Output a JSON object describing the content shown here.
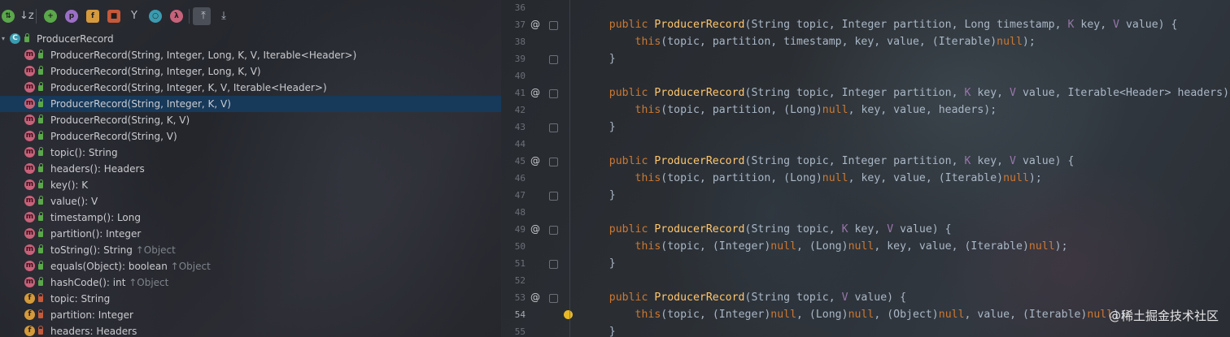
{
  "structure": {
    "toolbar": {
      "items": [
        {
          "name": "sort-by-visibility",
          "glyph": "⇅",
          "color": "#5aa84a"
        },
        {
          "name": "sort-alphabetically",
          "glyph": "↓z",
          "color": ""
        },
        {
          "name": "show-inherited",
          "glyph": "+",
          "color": "#5aa84a"
        },
        {
          "name": "show-properties",
          "glyph": "p",
          "color": "#9b6fc7"
        },
        {
          "name": "show-fields",
          "glyph": "f",
          "color": "#d59a3c"
        },
        {
          "name": "show-non-public",
          "glyph": "■",
          "color": "#c55a3a"
        },
        {
          "name": "show-anonymous",
          "glyph": "Y",
          "color": ""
        },
        {
          "name": "show-lambdas",
          "glyph": "○",
          "color": "#3b9bb0"
        },
        {
          "name": "show-lambdas-alt",
          "glyph": "λ",
          "color": "#c7627a"
        },
        {
          "name": "expand-all",
          "glyph": "⤒",
          "color": ""
        },
        {
          "name": "collapse-all",
          "glyph": "⤓",
          "color": ""
        }
      ]
    },
    "root": {
      "badge": "C",
      "label": "ProducerRecord"
    },
    "members": [
      {
        "kind": "m",
        "vis": "pub",
        "label": "ProducerRecord(String, Integer, Long, K, V, Iterable<Header>)",
        "inherited": ""
      },
      {
        "kind": "m",
        "vis": "pub",
        "label": "ProducerRecord(String, Integer, Long, K, V)",
        "inherited": ""
      },
      {
        "kind": "m",
        "vis": "pub",
        "label": "ProducerRecord(String, Integer, K, V, Iterable<Header>)",
        "inherited": ""
      },
      {
        "kind": "m",
        "vis": "pub",
        "label": "ProducerRecord(String, Integer, K, V)",
        "inherited": "",
        "selected": true
      },
      {
        "kind": "m",
        "vis": "pub",
        "label": "ProducerRecord(String, K, V)",
        "inherited": ""
      },
      {
        "kind": "m",
        "vis": "pub",
        "label": "ProducerRecord(String, V)",
        "inherited": ""
      },
      {
        "kind": "m",
        "vis": "pub",
        "label": "topic(): String",
        "inherited": ""
      },
      {
        "kind": "m",
        "vis": "pub",
        "label": "headers(): Headers",
        "inherited": ""
      },
      {
        "kind": "m",
        "vis": "pub",
        "label": "key(): K",
        "inherited": ""
      },
      {
        "kind": "m",
        "vis": "pub",
        "label": "value(): V",
        "inherited": ""
      },
      {
        "kind": "m",
        "vis": "pub",
        "label": "timestamp(): Long",
        "inherited": ""
      },
      {
        "kind": "m",
        "vis": "pub",
        "label": "partition(): Integer",
        "inherited": ""
      },
      {
        "kind": "m",
        "vis": "pub",
        "label": "toString(): String",
        "inherited": "↑Object"
      },
      {
        "kind": "m",
        "vis": "pub",
        "label": "equals(Object): boolean",
        "inherited": "↑Object"
      },
      {
        "kind": "m",
        "vis": "pub",
        "label": "hashCode(): int",
        "inherited": "↑Object"
      },
      {
        "kind": "f",
        "vis": "priv",
        "label": "topic: String",
        "inherited": ""
      },
      {
        "kind": "f",
        "vis": "priv",
        "label": "partition: Integer",
        "inherited": ""
      },
      {
        "kind": "f",
        "vis": "priv",
        "label": "headers: Headers",
        "inherited": ""
      }
    ]
  },
  "editor": {
    "lines": [
      {
        "num": "36",
        "marker": "",
        "fold": false,
        "bulb": false,
        "tokens": []
      },
      {
        "num": "37",
        "marker": "@",
        "fold": true,
        "bulb": false,
        "tokens": [
          [
            "",
            "    "
          ],
          [
            "kw",
            "public "
          ],
          [
            "fn",
            "ProducerRecord"
          ],
          [
            "",
            "(String topic, Integer partition, Long timestamp, "
          ],
          [
            "tp",
            "K"
          ],
          [
            "",
            " key, "
          ],
          [
            "tp",
            "V"
          ],
          [
            "",
            " value) {"
          ]
        ]
      },
      {
        "num": "38",
        "marker": "",
        "fold": false,
        "bulb": false,
        "tokens": [
          [
            "",
            "        "
          ],
          [
            "kw",
            "this"
          ],
          [
            "",
            "(topic, partition, timestamp, key, value, (Iterable)"
          ],
          [
            "kw",
            "null"
          ],
          [
            "",
            ");"
          ]
        ]
      },
      {
        "num": "39",
        "marker": "",
        "fold": true,
        "bulb": false,
        "tokens": [
          [
            "",
            "    }"
          ]
        ]
      },
      {
        "num": "40",
        "marker": "",
        "fold": false,
        "bulb": false,
        "tokens": []
      },
      {
        "num": "41",
        "marker": "@",
        "fold": true,
        "bulb": false,
        "tokens": [
          [
            "",
            "    "
          ],
          [
            "kw",
            "public "
          ],
          [
            "fn",
            "ProducerRecord"
          ],
          [
            "",
            "(String topic, Integer partition, "
          ],
          [
            "tp",
            "K"
          ],
          [
            "",
            " key, "
          ],
          [
            "tp",
            "V"
          ],
          [
            "",
            " value, Iterable<Header> headers) {"
          ]
        ]
      },
      {
        "num": "42",
        "marker": "",
        "fold": false,
        "bulb": false,
        "tokens": [
          [
            "",
            "        "
          ],
          [
            "kw",
            "this"
          ],
          [
            "",
            "(topic, partition, (Long)"
          ],
          [
            "kw",
            "null"
          ],
          [
            "",
            ", key, value, headers);"
          ]
        ]
      },
      {
        "num": "43",
        "marker": "",
        "fold": true,
        "bulb": false,
        "tokens": [
          [
            "",
            "    }"
          ]
        ]
      },
      {
        "num": "44",
        "marker": "",
        "fold": false,
        "bulb": false,
        "tokens": []
      },
      {
        "num": "45",
        "marker": "@",
        "fold": true,
        "bulb": false,
        "tokens": [
          [
            "",
            "    "
          ],
          [
            "kw",
            "public "
          ],
          [
            "fn",
            "ProducerRecord"
          ],
          [
            "",
            "(String topic, Integer partition, "
          ],
          [
            "tp",
            "K"
          ],
          [
            "",
            " key, "
          ],
          [
            "tp",
            "V"
          ],
          [
            "",
            " value) {"
          ]
        ]
      },
      {
        "num": "46",
        "marker": "",
        "fold": false,
        "bulb": false,
        "tokens": [
          [
            "",
            "        "
          ],
          [
            "kw",
            "this"
          ],
          [
            "",
            "(topic, partition, (Long)"
          ],
          [
            "kw",
            "null"
          ],
          [
            "",
            ", key, value, (Iterable)"
          ],
          [
            "kw",
            "null"
          ],
          [
            "",
            ");"
          ]
        ]
      },
      {
        "num": "47",
        "marker": "",
        "fold": true,
        "bulb": false,
        "tokens": [
          [
            "",
            "    }"
          ]
        ]
      },
      {
        "num": "48",
        "marker": "",
        "fold": false,
        "bulb": false,
        "tokens": []
      },
      {
        "num": "49",
        "marker": "@",
        "fold": true,
        "bulb": false,
        "tokens": [
          [
            "",
            "    "
          ],
          [
            "kw",
            "public "
          ],
          [
            "fn",
            "ProducerRecord"
          ],
          [
            "",
            "(String topic, "
          ],
          [
            "tp",
            "K"
          ],
          [
            "",
            " key, "
          ],
          [
            "tp",
            "V"
          ],
          [
            "",
            " value) {"
          ]
        ]
      },
      {
        "num": "50",
        "marker": "",
        "fold": false,
        "bulb": false,
        "tokens": [
          [
            "",
            "        "
          ],
          [
            "kw",
            "this"
          ],
          [
            "",
            "(topic, (Integer)"
          ],
          [
            "kw",
            "null"
          ],
          [
            "",
            ", (Long)"
          ],
          [
            "kw",
            "null"
          ],
          [
            "",
            ", key, value, (Iterable)"
          ],
          [
            "kw",
            "null"
          ],
          [
            "",
            ");"
          ]
        ]
      },
      {
        "num": "51",
        "marker": "",
        "fold": true,
        "bulb": false,
        "tokens": [
          [
            "",
            "    }"
          ]
        ]
      },
      {
        "num": "52",
        "marker": "",
        "fold": false,
        "bulb": false,
        "tokens": []
      },
      {
        "num": "53",
        "marker": "@",
        "fold": true,
        "bulb": false,
        "tokens": [
          [
            "",
            "    "
          ],
          [
            "kw",
            "public "
          ],
          [
            "fn",
            "ProducerRecord"
          ],
          [
            "",
            "(String topic, "
          ],
          [
            "tp",
            "V"
          ],
          [
            "",
            " value) {"
          ]
        ]
      },
      {
        "num": "54",
        "marker": "",
        "fold": false,
        "bulb": true,
        "current": true,
        "tokens": [
          [
            "",
            "        "
          ],
          [
            "kw",
            "this"
          ],
          [
            "",
            "(topic, (Integer)"
          ],
          [
            "kw",
            "null"
          ],
          [
            "",
            ", (Long)"
          ],
          [
            "kw",
            "null"
          ],
          [
            "",
            ", (Object)"
          ],
          [
            "kw",
            "null"
          ],
          [
            "",
            ", value, (Iterable)"
          ],
          [
            "kw",
            "null"
          ],
          [
            "",
            ");"
          ]
        ]
      },
      {
        "num": "55",
        "marker": "",
        "fold": false,
        "bulb": false,
        "tokens": [
          [
            "",
            "    }"
          ]
        ]
      }
    ],
    "watermark": "@稀土掘金技术社区"
  }
}
